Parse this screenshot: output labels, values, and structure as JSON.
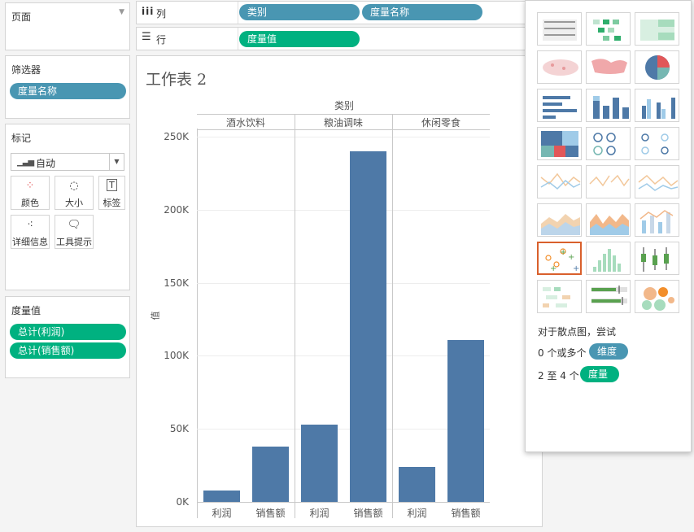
{
  "left_panel": {
    "pages_title": "页面",
    "filters_title": "筛选器",
    "filters_pill": "度量名称",
    "marks_title": "标记",
    "mark_type": "自动",
    "mark_buttons": [
      "颜色",
      "大小",
      "标签",
      "详细信息",
      "工具提示"
    ],
    "measures_title": "度量值",
    "measures_pills": [
      "总计(利润)",
      "总计(销售额)"
    ]
  },
  "shelves": {
    "columns_label": "列",
    "columns_pills": [
      "类别",
      "度量名称"
    ],
    "rows_label": "行",
    "rows_pills": [
      "度量值"
    ]
  },
  "worksheet": {
    "title": "工作表 2"
  },
  "chart_data": {
    "type": "bar",
    "column_header": "类别",
    "groups": [
      "酒水饮料",
      "粮油调味",
      "休闲零食"
    ],
    "categories": [
      "利润",
      "销售额"
    ],
    "ylabel": "值",
    "yticks": [
      "0K",
      "50K",
      "100K",
      "150K",
      "200K",
      "250K"
    ],
    "ylim": [
      0,
      250000
    ],
    "series": [
      {
        "group": "酒水饮料",
        "values": [
          8000,
          38000
        ]
      },
      {
        "group": "粮油调味",
        "values": [
          53000,
          240000
        ]
      },
      {
        "group": "休闲零食",
        "values": [
          24000,
          111000
        ]
      }
    ],
    "color": "#4e79a7"
  },
  "show_me": {
    "hint_line1": "对于散点图，尝试",
    "hint_line2_prefix": "0 个或多个",
    "hint_line2_pill": "维度",
    "hint_line3_prefix": "2 至 4 个",
    "hint_line3_pill": "度量"
  }
}
